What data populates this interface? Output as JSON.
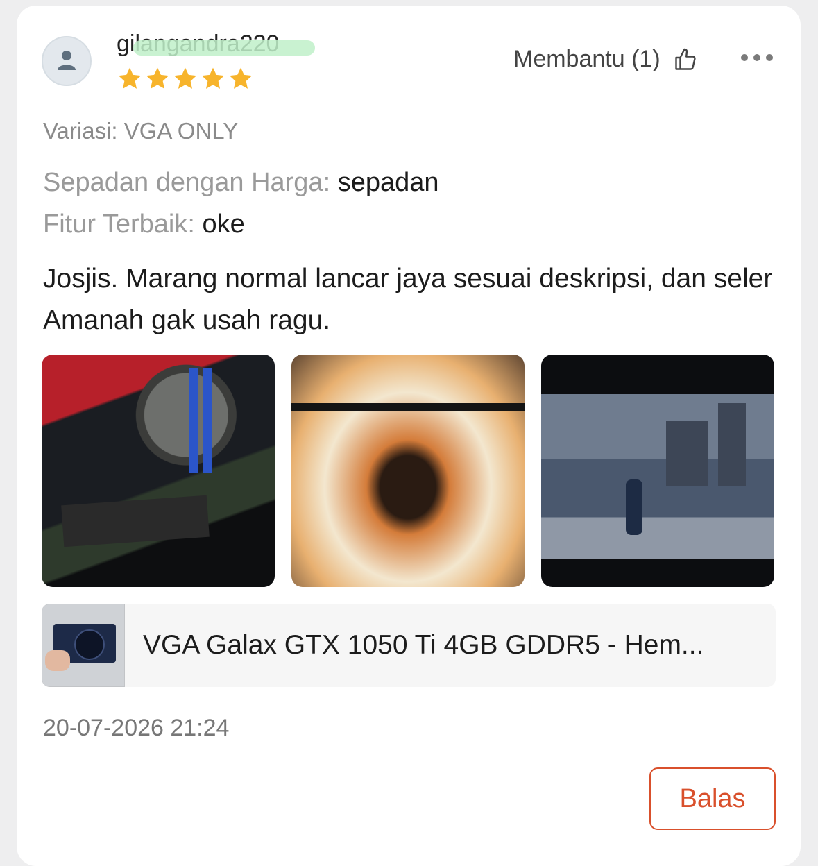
{
  "review": {
    "username": "gilangandra220",
    "rating": 5,
    "star_color": "#f7b42c",
    "helpful_label": "Membantu (1)",
    "variant": "Variasi: VGA ONLY",
    "attributes": [
      {
        "label": "Sepadan dengan Harga: ",
        "value": "sepadan"
      },
      {
        "label": "Fitur Terbaik: ",
        "value": "oke"
      }
    ],
    "text": "Josjis. Marang normal lancar jaya sesuai deskripsi, dan seler Amanah gak usah ragu.",
    "photos": [
      "pc-interior-photo",
      "monitor-fire-photo",
      "game-screenshot-photo"
    ],
    "product_title": "VGA Galax GTX 1050 Ti 4GB GDDR5 - Hem...",
    "date": "20-07-2026 21:24",
    "reply_label": "Balas",
    "accent_color": "#d9502c"
  }
}
